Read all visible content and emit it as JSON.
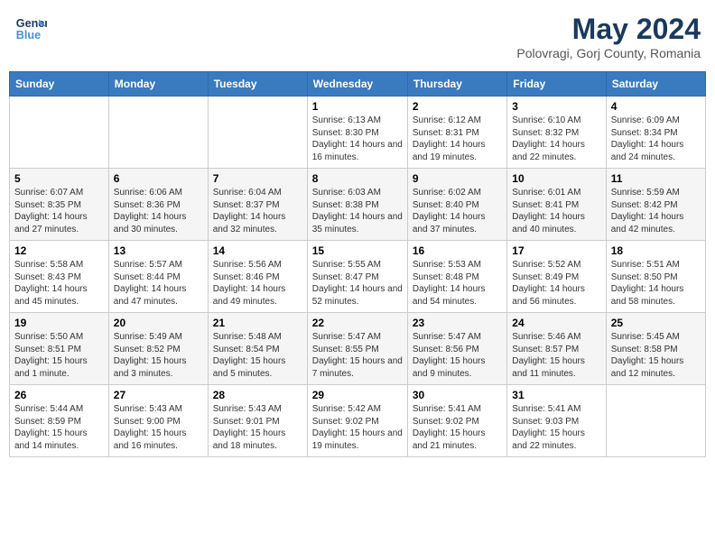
{
  "logo": {
    "line1": "General",
    "line2": "Blue"
  },
  "title": "May 2024",
  "subtitle": "Polovragi, Gorj County, Romania",
  "weekdays": [
    "Sunday",
    "Monday",
    "Tuesday",
    "Wednesday",
    "Thursday",
    "Friday",
    "Saturday"
  ],
  "weeks": [
    [
      {
        "day": "",
        "sunrise": "",
        "sunset": "",
        "daylight": ""
      },
      {
        "day": "",
        "sunrise": "",
        "sunset": "",
        "daylight": ""
      },
      {
        "day": "",
        "sunrise": "",
        "sunset": "",
        "daylight": ""
      },
      {
        "day": "1",
        "sunrise": "Sunrise: 6:13 AM",
        "sunset": "Sunset: 8:30 PM",
        "daylight": "Daylight: 14 hours and 16 minutes."
      },
      {
        "day": "2",
        "sunrise": "Sunrise: 6:12 AM",
        "sunset": "Sunset: 8:31 PM",
        "daylight": "Daylight: 14 hours and 19 minutes."
      },
      {
        "day": "3",
        "sunrise": "Sunrise: 6:10 AM",
        "sunset": "Sunset: 8:32 PM",
        "daylight": "Daylight: 14 hours and 22 minutes."
      },
      {
        "day": "4",
        "sunrise": "Sunrise: 6:09 AM",
        "sunset": "Sunset: 8:34 PM",
        "daylight": "Daylight: 14 hours and 24 minutes."
      }
    ],
    [
      {
        "day": "5",
        "sunrise": "Sunrise: 6:07 AM",
        "sunset": "Sunset: 8:35 PM",
        "daylight": "Daylight: 14 hours and 27 minutes."
      },
      {
        "day": "6",
        "sunrise": "Sunrise: 6:06 AM",
        "sunset": "Sunset: 8:36 PM",
        "daylight": "Daylight: 14 hours and 30 minutes."
      },
      {
        "day": "7",
        "sunrise": "Sunrise: 6:04 AM",
        "sunset": "Sunset: 8:37 PM",
        "daylight": "Daylight: 14 hours and 32 minutes."
      },
      {
        "day": "8",
        "sunrise": "Sunrise: 6:03 AM",
        "sunset": "Sunset: 8:38 PM",
        "daylight": "Daylight: 14 hours and 35 minutes."
      },
      {
        "day": "9",
        "sunrise": "Sunrise: 6:02 AM",
        "sunset": "Sunset: 8:40 PM",
        "daylight": "Daylight: 14 hours and 37 minutes."
      },
      {
        "day": "10",
        "sunrise": "Sunrise: 6:01 AM",
        "sunset": "Sunset: 8:41 PM",
        "daylight": "Daylight: 14 hours and 40 minutes."
      },
      {
        "day": "11",
        "sunrise": "Sunrise: 5:59 AM",
        "sunset": "Sunset: 8:42 PM",
        "daylight": "Daylight: 14 hours and 42 minutes."
      }
    ],
    [
      {
        "day": "12",
        "sunrise": "Sunrise: 5:58 AM",
        "sunset": "Sunset: 8:43 PM",
        "daylight": "Daylight: 14 hours and 45 minutes."
      },
      {
        "day": "13",
        "sunrise": "Sunrise: 5:57 AM",
        "sunset": "Sunset: 8:44 PM",
        "daylight": "Daylight: 14 hours and 47 minutes."
      },
      {
        "day": "14",
        "sunrise": "Sunrise: 5:56 AM",
        "sunset": "Sunset: 8:46 PM",
        "daylight": "Daylight: 14 hours and 49 minutes."
      },
      {
        "day": "15",
        "sunrise": "Sunrise: 5:55 AM",
        "sunset": "Sunset: 8:47 PM",
        "daylight": "Daylight: 14 hours and 52 minutes."
      },
      {
        "day": "16",
        "sunrise": "Sunrise: 5:53 AM",
        "sunset": "Sunset: 8:48 PM",
        "daylight": "Daylight: 14 hours and 54 minutes."
      },
      {
        "day": "17",
        "sunrise": "Sunrise: 5:52 AM",
        "sunset": "Sunset: 8:49 PM",
        "daylight": "Daylight: 14 hours and 56 minutes."
      },
      {
        "day": "18",
        "sunrise": "Sunrise: 5:51 AM",
        "sunset": "Sunset: 8:50 PM",
        "daylight": "Daylight: 14 hours and 58 minutes."
      }
    ],
    [
      {
        "day": "19",
        "sunrise": "Sunrise: 5:50 AM",
        "sunset": "Sunset: 8:51 PM",
        "daylight": "Daylight: 15 hours and 1 minute."
      },
      {
        "day": "20",
        "sunrise": "Sunrise: 5:49 AM",
        "sunset": "Sunset: 8:52 PM",
        "daylight": "Daylight: 15 hours and 3 minutes."
      },
      {
        "day": "21",
        "sunrise": "Sunrise: 5:48 AM",
        "sunset": "Sunset: 8:54 PM",
        "daylight": "Daylight: 15 hours and 5 minutes."
      },
      {
        "day": "22",
        "sunrise": "Sunrise: 5:47 AM",
        "sunset": "Sunset: 8:55 PM",
        "daylight": "Daylight: 15 hours and 7 minutes."
      },
      {
        "day": "23",
        "sunrise": "Sunrise: 5:47 AM",
        "sunset": "Sunset: 8:56 PM",
        "daylight": "Daylight: 15 hours and 9 minutes."
      },
      {
        "day": "24",
        "sunrise": "Sunrise: 5:46 AM",
        "sunset": "Sunset: 8:57 PM",
        "daylight": "Daylight: 15 hours and 11 minutes."
      },
      {
        "day": "25",
        "sunrise": "Sunrise: 5:45 AM",
        "sunset": "Sunset: 8:58 PM",
        "daylight": "Daylight: 15 hours and 12 minutes."
      }
    ],
    [
      {
        "day": "26",
        "sunrise": "Sunrise: 5:44 AM",
        "sunset": "Sunset: 8:59 PM",
        "daylight": "Daylight: 15 hours and 14 minutes."
      },
      {
        "day": "27",
        "sunrise": "Sunrise: 5:43 AM",
        "sunset": "Sunset: 9:00 PM",
        "daylight": "Daylight: 15 hours and 16 minutes."
      },
      {
        "day": "28",
        "sunrise": "Sunrise: 5:43 AM",
        "sunset": "Sunset: 9:01 PM",
        "daylight": "Daylight: 15 hours and 18 minutes."
      },
      {
        "day": "29",
        "sunrise": "Sunrise: 5:42 AM",
        "sunset": "Sunset: 9:02 PM",
        "daylight": "Daylight: 15 hours and 19 minutes."
      },
      {
        "day": "30",
        "sunrise": "Sunrise: 5:41 AM",
        "sunset": "Sunset: 9:02 PM",
        "daylight": "Daylight: 15 hours and 21 minutes."
      },
      {
        "day": "31",
        "sunrise": "Sunrise: 5:41 AM",
        "sunset": "Sunset: 9:03 PM",
        "daylight": "Daylight: 15 hours and 22 minutes."
      },
      {
        "day": "",
        "sunrise": "",
        "sunset": "",
        "daylight": ""
      }
    ]
  ]
}
